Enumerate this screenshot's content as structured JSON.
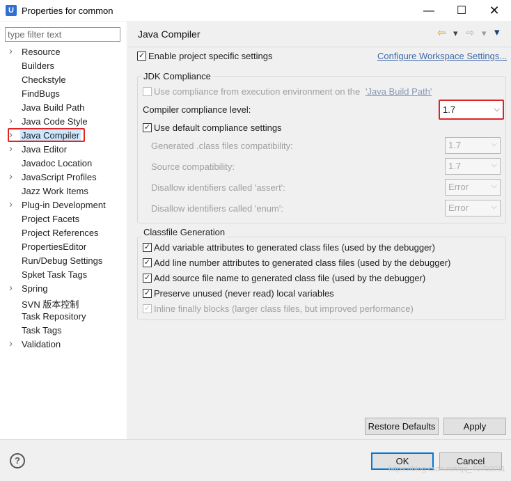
{
  "window": {
    "icon_letter": "U",
    "title": "Properties for common",
    "minimize": "—",
    "maximize": "☐",
    "close": "✕"
  },
  "left": {
    "filter_placeholder": "type filter text",
    "items": [
      {
        "label": "Resource",
        "expandable": true
      },
      {
        "label": "Builders",
        "expandable": false
      },
      {
        "label": "Checkstyle",
        "expandable": false
      },
      {
        "label": "FindBugs",
        "expandable": false
      },
      {
        "label": "Java Build Path",
        "expandable": false
      },
      {
        "label": "Java Code Style",
        "expandable": true
      },
      {
        "label": "Java Compiler",
        "expandable": true,
        "selected": true
      },
      {
        "label": "Java Editor",
        "expandable": true
      },
      {
        "label": "Javadoc Location",
        "expandable": false
      },
      {
        "label": "JavaScript Profiles",
        "expandable": true
      },
      {
        "label": "Jazz Work Items",
        "expandable": false
      },
      {
        "label": "Plug-in Development",
        "expandable": true
      },
      {
        "label": "Project Facets",
        "expandable": false
      },
      {
        "label": "Project References",
        "expandable": false
      },
      {
        "label": "PropertiesEditor",
        "expandable": false
      },
      {
        "label": "Run/Debug Settings",
        "expandable": false
      },
      {
        "label": "Spket Task Tags",
        "expandable": false
      },
      {
        "label": "Spring",
        "expandable": true
      },
      {
        "label": "SVN 版本控制",
        "expandable": false
      },
      {
        "label": "Task Repository",
        "expandable": false
      },
      {
        "label": "Task Tags",
        "expandable": false
      },
      {
        "label": "Validation",
        "expandable": true
      }
    ]
  },
  "main": {
    "title": "Java Compiler",
    "nav": {
      "back": "⇦",
      "back_menu": "▾",
      "forward": "⇨",
      "forward_menu": "▾",
      "menu": "▾"
    },
    "enable_project_specific": "Enable project specific settings",
    "configure_workspace": "Configure Workspace Settings...",
    "jdk": {
      "group_title": "JDK Compliance",
      "use_exec_env": "Use compliance from execution environment on the ",
      "build_path_link": "'Java Build Path'",
      "compliance_level_label": "Compiler compliance level:",
      "compliance_level_value": "1.7",
      "use_default": "Use default compliance settings",
      "generated_class_label": "Generated .class files compatibility:",
      "generated_class_value": "1.7",
      "source_compat_label": "Source compatibility:",
      "source_compat_value": "1.7",
      "assert_label": "Disallow identifiers called 'assert':",
      "assert_value": "Error",
      "enum_label": "Disallow identifiers called 'enum':",
      "enum_value": "Error"
    },
    "classfile": {
      "group_title": "Classfile Generation",
      "opt1": "Add variable attributes to generated class files (used by the debugger)",
      "opt2": "Add line number attributes to generated class files (used by the debugger)",
      "opt3": "Add source file name to generated class file (used by the debugger)",
      "opt4": "Preserve unused (never read) local variables",
      "opt5": "Inline finally blocks (larger class files, but improved performance)"
    },
    "restore_defaults": "Restore Defaults",
    "apply": "Apply"
  },
  "bottom": {
    "help": "?",
    "ok": "OK",
    "cancel": "Cancel",
    "watermark": "https://blog.csdn.net/qq_40702011"
  },
  "colors": {
    "highlight": "#e02424",
    "selection": "#cce8ff",
    "link": "#3e6aa8",
    "default_button_border": "#0078d7"
  },
  "checkmark": "✓",
  "chevron": "⌵"
}
